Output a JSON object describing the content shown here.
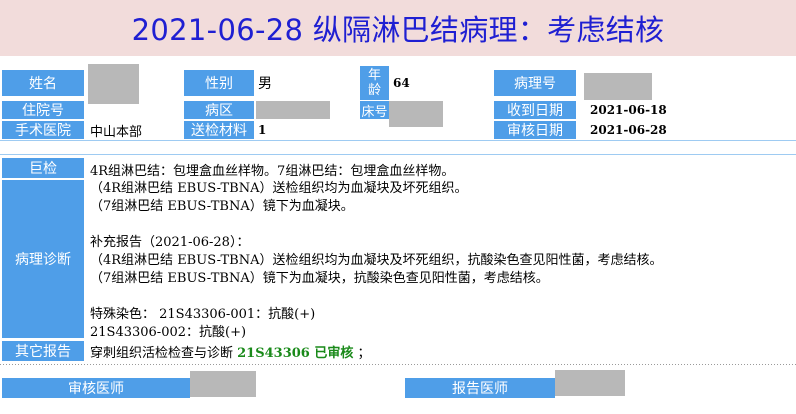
{
  "title": "2021-06-28 纵隔淋巴结病理：考虑结核",
  "labels": {
    "name": "姓名",
    "gender": "性别",
    "age": "年\n龄",
    "pathology_no": "病理号",
    "inpatient_no": "住院号",
    "ward": "病区",
    "bed": "床号",
    "received_date": "收到日期",
    "hospital": "手术医院",
    "specimen": "送检材料",
    "review_date": "审核日期",
    "gross": "巨检",
    "diagnosis": "病理诊断",
    "other_report": "其它报告",
    "reviewer": "审核医师",
    "reporter": "报告医师"
  },
  "values": {
    "gender": "男",
    "age": "64",
    "received_date": "2021-06-18",
    "hospital": "中山本部",
    "specimen": "1",
    "review_date": "2021-06-28"
  },
  "gross_text": "4R组淋巴结：包埋盒血丝样物。7组淋巴结：包埋盒血丝样物。",
  "diagnosis_lines": [
    "（4R组淋巴结 EBUS-TBNA）送检组织均为血凝块及坏死组织。",
    "（7组淋巴结 EBUS-TBNA）镜下为血凝块。",
    "",
    "补充报告（2021-06-28）：",
    "（4R组淋巴结 EBUS-TBNA）送检组织均为血凝块及坏死组织，抗酸染色查见阳性菌，考虑结核。",
    "（7组淋巴结 EBUS-TBNA）镜下为血凝块，抗酸染色查见阳性菌，考虑结核。",
    "",
    "特殊染色： 21S43306-001：抗酸(+)",
    "21S43306-002：抗酸(+)"
  ],
  "other_report": {
    "prefix": "穿刺组织活检检查与诊断 ",
    "code_status": "21S43306 已审核",
    "suffix": " ；"
  },
  "colors": {
    "label_bg": "#4f9ee8",
    "title_bg": "#f2dcdb",
    "title_text": "#1f1fd2",
    "status_green": "#1a8a1a"
  }
}
